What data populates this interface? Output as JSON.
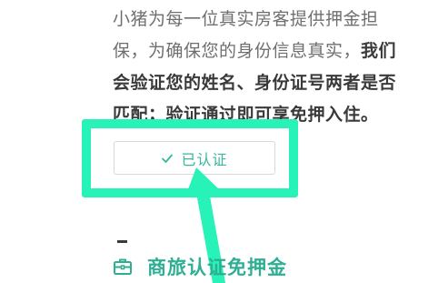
{
  "description": {
    "lead": "小猪为每一位真实房客提供押金担保，为确保您的身份信息真实，",
    "bold": "我们会验证您的姓名、身份证号两者是否匹配；验证通过即可享免押入住。"
  },
  "verify_button": {
    "label": "已认证",
    "icon": "check-icon"
  },
  "business_section": {
    "icon": "briefcase-icon",
    "label": "商旅认证免押金"
  },
  "colors": {
    "highlight": "#27f2b7",
    "brand_green": "#2eaf93",
    "body_text": "#6f6f6f",
    "bold_text": "#3a3a3a"
  }
}
